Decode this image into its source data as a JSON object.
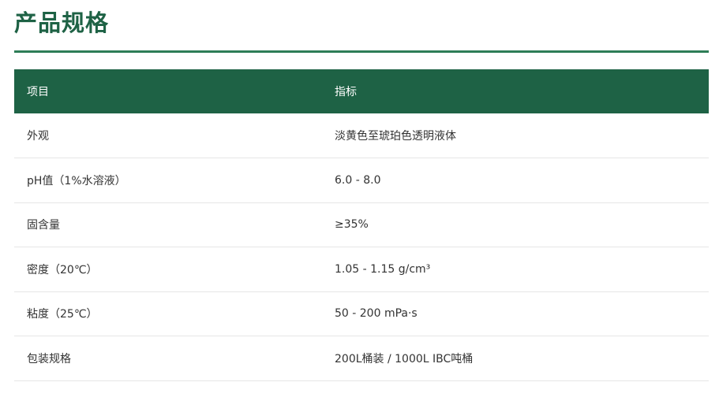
{
  "section": {
    "title": "产品规格"
  },
  "table": {
    "headers": [
      "项目",
      "指标"
    ],
    "rows": [
      {
        "item": "外观",
        "value": "淡黄色至琥珀色透明液体"
      },
      {
        "item": "pH值（1%水溶液）",
        "value": "6.0 - 8.0"
      },
      {
        "item": "固含量",
        "value": "≥35%"
      },
      {
        "item": "密度（20℃）",
        "value": "1.05 - 1.15 g/cm³"
      },
      {
        "item": "粘度（25℃）",
        "value": "50 - 200 mPa·s"
      },
      {
        "item": "包装规格",
        "value": "200L桶装 / 1000L IBC吨桶"
      }
    ]
  },
  "colors": {
    "brand_green": "#1e6245",
    "rule_green": "#2e7d57",
    "row_divider": "#e6e6e6",
    "text": "#333333"
  }
}
